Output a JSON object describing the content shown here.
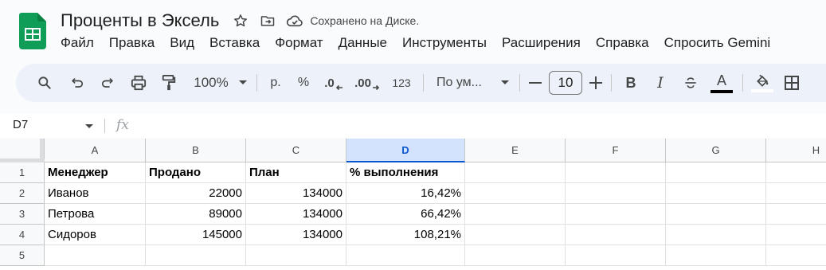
{
  "doc": {
    "title": "Проценты в Эксель",
    "saved_status": "Сохранено на Диске."
  },
  "menu": [
    "Файл",
    "Правка",
    "Вид",
    "Вставка",
    "Формат",
    "Данные",
    "Инструменты",
    "Расширения",
    "Справка",
    "Спросить Gemini"
  ],
  "toolbar": {
    "zoom": "100%",
    "currency": "р.",
    "percent": "%",
    "decrease_decimals": ".0",
    "increase_decimals": ".00",
    "number_format": "123",
    "font": "По ум...",
    "font_size": "10",
    "bold": "B",
    "italic": "I",
    "text_color_letter": "A",
    "text_color": "#000000",
    "fill_color": "#ffffff"
  },
  "formula_bar": {
    "cell_ref": "D7",
    "fx": "fx"
  },
  "sheet": {
    "columns": [
      "A",
      "B",
      "C",
      "D",
      "E",
      "F",
      "G",
      "H"
    ],
    "selected_column": "D",
    "rows": [
      "1",
      "2",
      "3",
      "4",
      "5"
    ],
    "cells": [
      [
        "Менеджер",
        "Продано",
        "План",
        "% выполнения"
      ],
      [
        "Иванов",
        "22000",
        "134000",
        "16,42%"
      ],
      [
        "Петрова",
        "89000",
        "134000",
        "66,42%"
      ],
      [
        "Сидоров",
        "145000",
        "134000",
        "108,21%"
      ]
    ]
  },
  "colors": {
    "accent": "#0b57d0",
    "sheets_green": "#0f9d58",
    "selected_header_bg": "#d3e3fd",
    "toolbar_bg": "#edf2fa"
  }
}
